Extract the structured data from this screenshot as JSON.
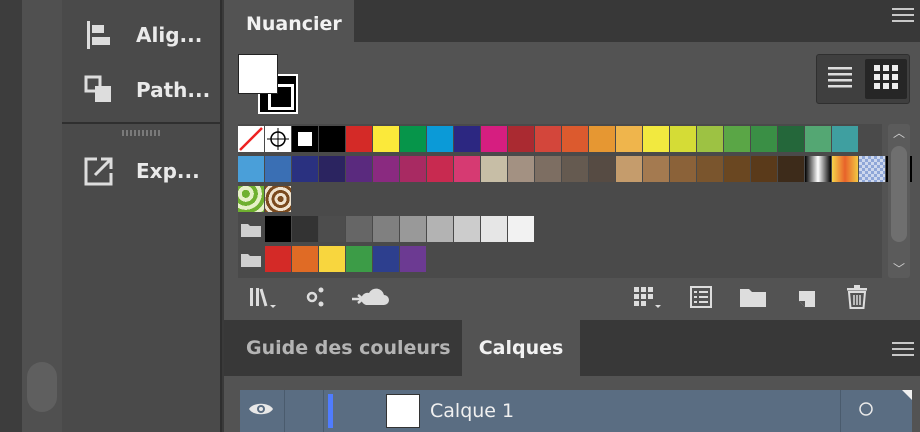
{
  "left_panel": {
    "tools": [
      {
        "name": "Alig...",
        "icon": "align-icon"
      },
      {
        "name": "Path...",
        "icon": "pathfinder-icon"
      },
      {
        "name": "Exp...",
        "icon": "export-icon"
      }
    ]
  },
  "swatches_panel": {
    "title": "Nuancier",
    "row1": [
      "none",
      "registration",
      "white-black",
      "#000000",
      "#d42a27",
      "#fbe93a",
      "#06954a",
      "#0b9ad7",
      "#2c2781",
      "#d61e80",
      "#aa2a31",
      "#d3463b",
      "#dc5a2e",
      "#e69732",
      "#efb54c",
      "#f2e93f",
      "#d5dc36",
      "#9dc243",
      "#5aa646",
      "#3a8f45",
      "#24673a",
      "#54a773",
      "#3f9fa0"
    ],
    "row2": [
      "#4a9fd9",
      "#3a6fb4",
      "#2a3180",
      "#2b2460",
      "#5a2a7e",
      "#8a2a80",
      "#a82a62",
      "#c82a50",
      "#d63a72",
      "#c7bea6",
      "#a39182",
      "#7d6e62",
      "#655a50",
      "#564b43",
      "#c59c6c",
      "#a47a50",
      "#8b6239",
      "#7a552d",
      "#6a4721",
      "#5a3a1a",
      "#3d2b1a",
      "gradient-bw",
      "gradient-orange",
      "pattern-check",
      "pattern-dots"
    ],
    "row3": [
      "pattern-leaves",
      "pattern-swirl"
    ],
    "row4_gray": [
      "#000000",
      "#333333",
      "#4d4d4d",
      "#666666",
      "#808080",
      "#999999",
      "#b3b3b3",
      "#cccccc",
      "#e6e6e6",
      "#f2f2f2"
    ],
    "row5_brights": [
      "#d42a27",
      "#e06b25",
      "#f8d63e",
      "#3c9c47",
      "#2d3f8e",
      "#6c3a92"
    ]
  },
  "bottom_tabs": [
    {
      "label": "Guide des couleurs"
    },
    {
      "label": "Calques"
    }
  ],
  "layers": [
    {
      "name": "Calque 1",
      "visible": true,
      "color": "#4f7cff"
    }
  ],
  "colors": {
    "accent": "#4f7cff",
    "selected_row": "#5a6d82"
  }
}
